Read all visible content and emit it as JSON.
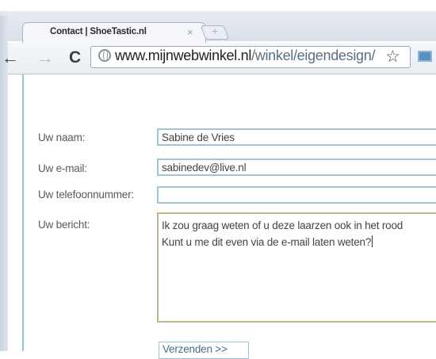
{
  "browser": {
    "tab_title": "Contact | ShoeTastic.nl",
    "tab_close": "×",
    "new_tab": "+",
    "back": "←",
    "forward": "→",
    "reload": "C",
    "url_host": "www.mijnwebwinkel.nl",
    "url_path": "/winkel/eigendesign/",
    "bookmark": "☆"
  },
  "form": {
    "name_label": "Uw naam:",
    "name_value": "Sabine de Vries",
    "email_label": "Uw e-mail:",
    "email_value": "sabinedev@live.nl",
    "phone_label": "Uw telefoonnummer:",
    "phone_value": "",
    "message_label": "Uw bericht:",
    "message_line1": "Ik zou graag weten of u deze laarzen ook in het rood",
    "message_line2": "Kunt u me dit even via de e-mail laten weten?",
    "submit_label": "Verzenden >>"
  }
}
